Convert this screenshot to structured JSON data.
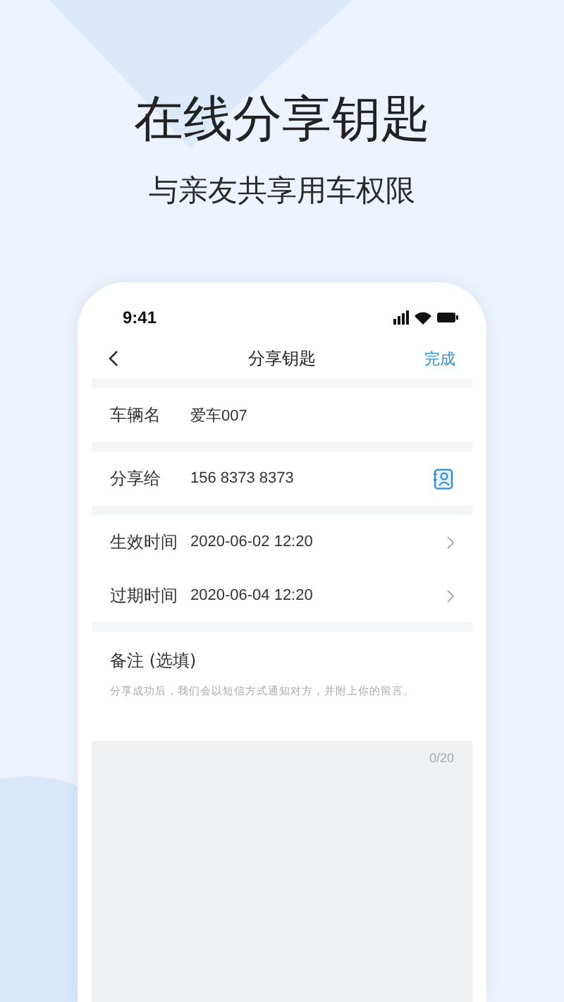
{
  "headline": "在线分享钥匙",
  "subtitle": "与亲友共享用车权限",
  "phone": {
    "status_time": "9:41",
    "nav": {
      "title": "分享钥匙",
      "action": "完成"
    },
    "fields": [
      {
        "kind": "text",
        "label": "车辆名",
        "value": "爱车007"
      },
      {
        "kind": "contact",
        "label": "分享给",
        "value": "156 8373 8373"
      },
      {
        "kind": "picker",
        "label": "生效时间",
        "value": "2020-06-02 12:20"
      },
      {
        "kind": "picker",
        "label": "过期时间",
        "value": "2020-06-04 12:20"
      }
    ],
    "note": {
      "label": "备注 (选填)",
      "hint": "分享成功后，我们会以短信方式通知对方，并附上你的留言。",
      "counter": "0/20"
    }
  }
}
